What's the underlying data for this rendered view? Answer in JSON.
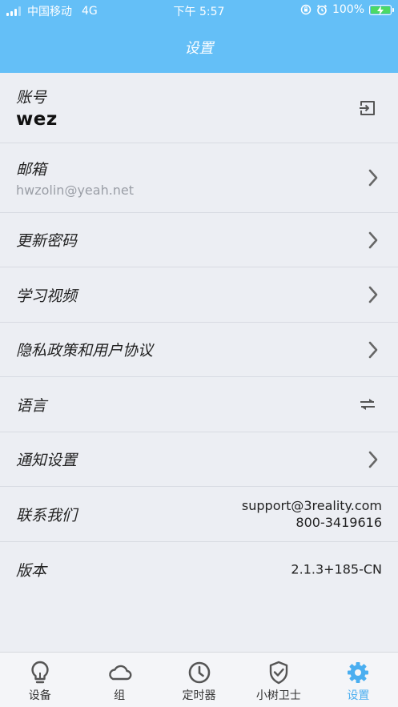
{
  "status_bar": {
    "carrier": "中国移动",
    "network": "4G",
    "time": "下午 5:57",
    "battery": "100%"
  },
  "header": {
    "title": "设置"
  },
  "rows": {
    "account": {
      "label": "账号",
      "value": "wez"
    },
    "email": {
      "label": "邮箱",
      "value": "hwzolin@yeah.net"
    },
    "password": {
      "label": "更新密码"
    },
    "videos": {
      "label": "学习视频"
    },
    "privacy": {
      "label": "隐私政策和用户协议"
    },
    "language": {
      "label": "语言"
    },
    "notifications": {
      "label": "通知设置"
    },
    "contact": {
      "label": "联系我们",
      "email": "support@3reality.com",
      "phone": "800-3419616"
    },
    "version": {
      "label": "版本",
      "value": "2.1.3+185-CN"
    }
  },
  "tabs": [
    {
      "label": "设备",
      "icon": "lightbulb-icon"
    },
    {
      "label": "组",
      "icon": "cloud-icon"
    },
    {
      "label": "定时器",
      "icon": "clock-icon"
    },
    {
      "label": "小树卫士",
      "icon": "shield-icon"
    },
    {
      "label": "设置",
      "icon": "gear-icon",
      "active": true
    }
  ],
  "colors": {
    "header": "#64bff7",
    "active_tab": "#4aaef0",
    "background": "#eceef3"
  }
}
